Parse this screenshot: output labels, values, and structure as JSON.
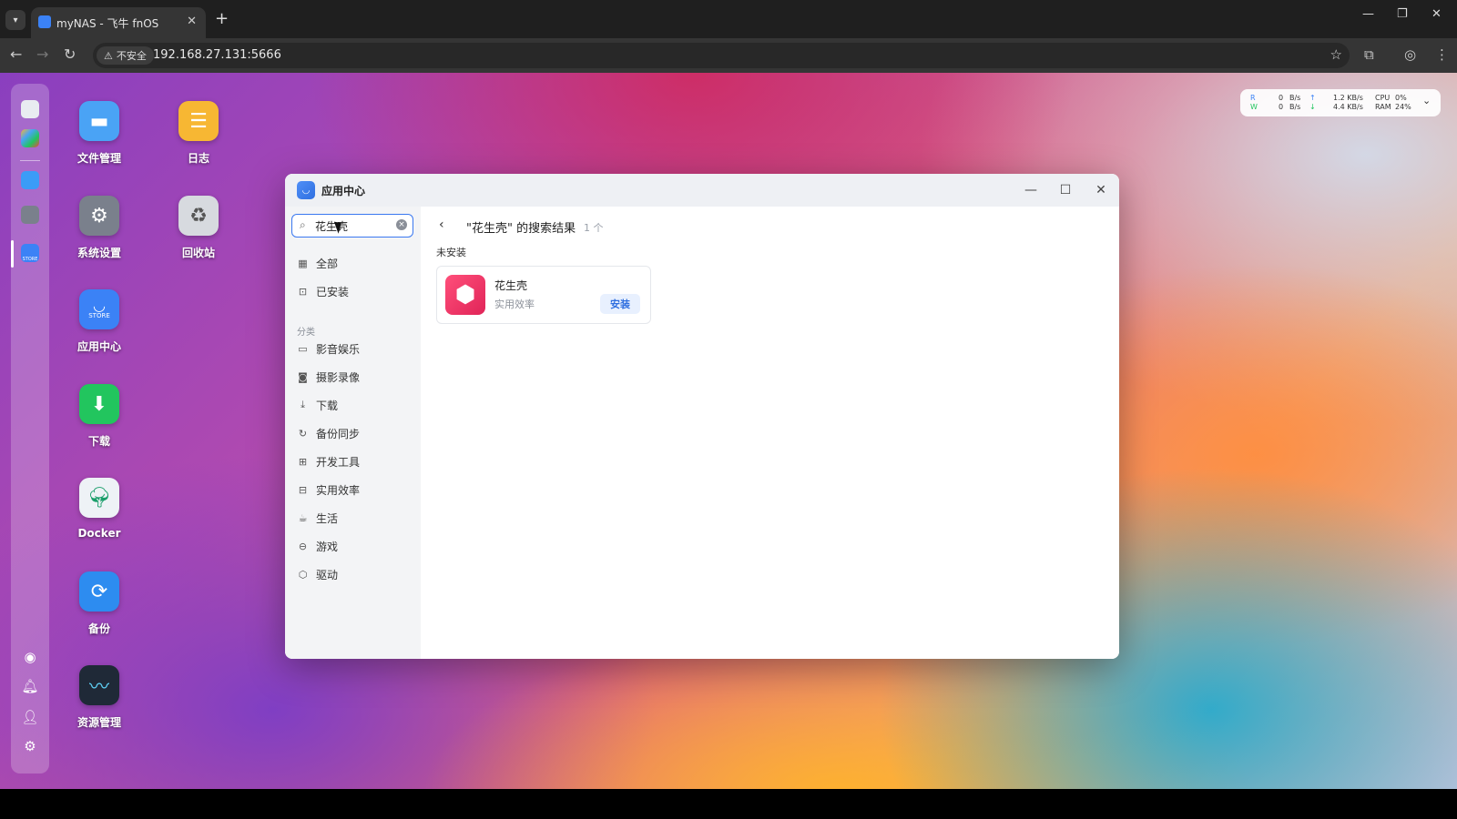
{
  "browser": {
    "tab_title": "myNAS - 飞牛 fnOS",
    "insecure_label": "不安全",
    "url": "192.168.27.131:5666"
  },
  "desktop": {
    "icons": [
      {
        "label": "文件管理",
        "icon": "folder-icon",
        "color": "#4aa3f5"
      },
      {
        "label": "日志",
        "icon": "log-icon",
        "color": "#f7b733"
      },
      {
        "label": "系统设置",
        "icon": "gear-icon",
        "color": "#7a808c"
      },
      {
        "label": "回收站",
        "icon": "recycle-icon",
        "color": "#d7dadf"
      },
      {
        "label": "应用中心",
        "icon": "store-icon",
        "color": "#3b82f6"
      },
      {
        "label": "下载",
        "icon": "download-icon",
        "color": "#22c55e"
      },
      {
        "label": "Docker",
        "icon": "docker-icon",
        "color": "#eef2f6"
      },
      {
        "label": "备份",
        "icon": "backup-icon",
        "color": "#2d8cf0"
      },
      {
        "label": "资源管理",
        "icon": "monitor-icon",
        "color": "#1f2937"
      }
    ],
    "dock_store_text": "STORE"
  },
  "widget": {
    "r_label": "R",
    "w_label": "W",
    "r_rate": "0",
    "w_rate": "0",
    "unit": "B/s",
    "up_rate": "1.2 KB/s",
    "down_rate": "4.4 KB/s",
    "cpu_label": "CPU",
    "ram_label": "RAM",
    "cpu_value": "0%",
    "ram_value": "24%"
  },
  "app": {
    "title": "应用中心",
    "search": {
      "value": "花生壳"
    },
    "menu": [
      {
        "label": "全部",
        "icon": "grid-icon"
      },
      {
        "label": "已安装",
        "icon": "installed-icon"
      }
    ],
    "category_header": "分类",
    "categories": [
      {
        "label": "影音娱乐",
        "icon": "video-icon"
      },
      {
        "label": "摄影录像",
        "icon": "camera-icon"
      },
      {
        "label": "下载",
        "icon": "download-icon"
      },
      {
        "label": "备份同步",
        "icon": "sync-icon"
      },
      {
        "label": "开发工具",
        "icon": "code-icon"
      },
      {
        "label": "实用效率",
        "icon": "briefcase-icon"
      },
      {
        "label": "生活",
        "icon": "cup-icon"
      },
      {
        "label": "游戏",
        "icon": "gamepad-icon"
      },
      {
        "label": "驱动",
        "icon": "cube-icon"
      }
    ],
    "results": {
      "title": "\"花生壳\" 的搜索结果",
      "count": "1 个",
      "section": "未安装",
      "card": {
        "name": "花生壳",
        "category": "实用效率",
        "install_label": "安装"
      }
    }
  }
}
